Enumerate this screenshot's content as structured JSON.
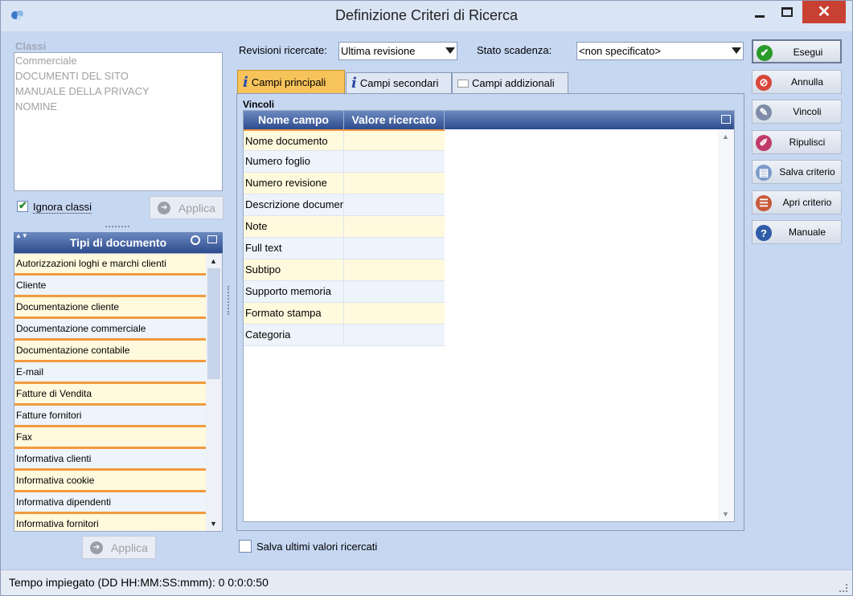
{
  "window": {
    "title": "Definizione Criteri di Ricerca",
    "minimize_icon": "minimize-icon",
    "maximize_icon": "maximize-icon",
    "close_glyph": "✕"
  },
  "classi": {
    "label": "Classi",
    "items": [
      "Commerciale",
      "DOCUMENTI DEL SITO",
      "MANUALE DELLA PRIVACY",
      "NOMINE"
    ]
  },
  "ignora_classi": {
    "label": "Ignora classi",
    "checked": true
  },
  "apply": {
    "label": "Applica"
  },
  "tipi": {
    "header": "Tipi di documento",
    "items": [
      "Autorizzazioni loghi e marchi clienti",
      "Cliente",
      "Documentazione cliente",
      "Documentazione commerciale",
      "Documentazione contabile",
      "E-mail",
      "Fatture di Vendita",
      "Fatture fornitori",
      "Fax",
      "Informativa clienti",
      "Informativa cookie",
      "Informativa dipendenti",
      "Informativa fornitori"
    ]
  },
  "filters": {
    "revisioni_label": "Revisioni ricercate:",
    "revisioni_value": "Ultima revisione",
    "stato_label": "Stato scadenza:",
    "stato_value": "<non specificato>"
  },
  "tabs": [
    {
      "label": "Campi principali",
      "active": true
    },
    {
      "label": "Campi secondari",
      "active": false
    },
    {
      "label": "Campi addizionali",
      "active": false
    }
  ],
  "vincoli": {
    "label": "Vincoli",
    "col_name": "Nome campo",
    "col_value": "Valore ricercato",
    "rows": [
      "Nome documento",
      "Numero foglio",
      "Numero revisione",
      "Descrizione documento",
      "Note",
      "Full text",
      "Subtipo",
      "Supporto memoria",
      "Formato stampa",
      "Categoria"
    ]
  },
  "salva_ultimi": {
    "label": "Salva ultimi valori ricercati",
    "checked": false
  },
  "actions": [
    {
      "label": "Esegui",
      "icon": "check-icon",
      "color": "#2a9a2a",
      "glyph": "✔"
    },
    {
      "label": "Annulla",
      "icon": "cancel-icon",
      "color": "#d8463a",
      "glyph": "⊘"
    },
    {
      "label": "Vincoli",
      "icon": "tools-icon",
      "color": "#7f8da8",
      "glyph": "✎"
    },
    {
      "label": "Ripulisci",
      "icon": "eraser-icon",
      "color": "#c23a6a",
      "glyph": "✐"
    },
    {
      "label": "Salva criterio",
      "icon": "save-icon",
      "color": "#7a9ac8",
      "glyph": "▤"
    },
    {
      "label": "Apri criterio",
      "icon": "open-icon",
      "color": "#c85a3a",
      "glyph": "☰"
    },
    {
      "label": "Manuale",
      "icon": "help-icon",
      "color": "#2f5ca8",
      "glyph": "?"
    }
  ],
  "status": {
    "text": "Tempo impiegato (DD HH:MM:SS:mmm): 0 0:0:0:50"
  }
}
